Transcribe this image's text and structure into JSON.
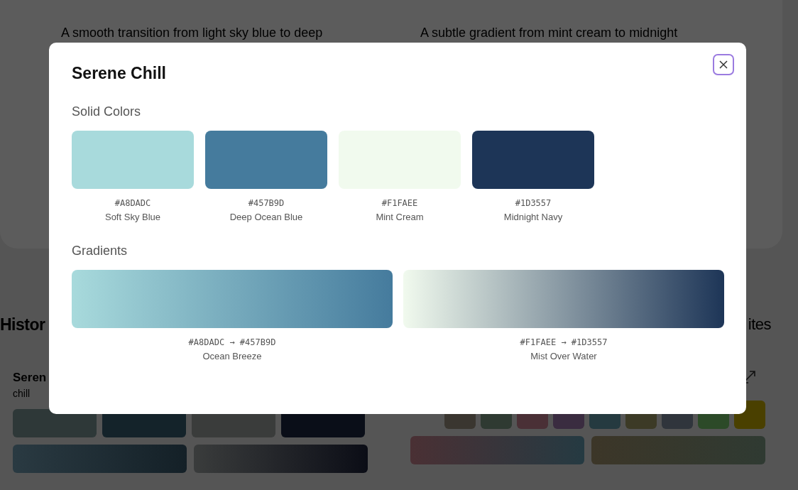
{
  "background": {
    "descriptions": [
      "A smooth transition from light sky blue to deep",
      "A subtle gradient from mint cream to midnight"
    ],
    "history_heading": "Histor",
    "favorites_heading": "ites",
    "history_card": {
      "title": "Seren",
      "tag": "chill",
      "swatches": [
        {
          "color": "#2e3838"
        },
        {
          "color": "#14232a"
        },
        {
          "color": "#3a3c3b"
        },
        {
          "color": "#0a0e18"
        }
      ]
    },
    "favorites_card": {
      "swatches": [
        {
          "color": "#3a3630"
        },
        {
          "color": "#2f3a32"
        },
        {
          "color": "#4a3036"
        },
        {
          "color": "#3a2c40"
        },
        {
          "color": "#253a40"
        },
        {
          "color": "#3c3a26"
        },
        {
          "color": "#30353c"
        },
        {
          "color": "#2c4a28"
        },
        {
          "color": "#4a4000"
        }
      ]
    }
  },
  "modal": {
    "title": "Serene Chill",
    "solid_heading": "Solid Colors",
    "gradients_heading": "Gradients",
    "colors": [
      {
        "hex": "#A8DADC",
        "name": "Soft Sky Blue",
        "color": "#a8dadc"
      },
      {
        "hex": "#457B9D",
        "name": "Deep Ocean Blue",
        "color": "#457b9d"
      },
      {
        "hex": "#F1FAEE",
        "name": "Mint Cream",
        "color": "#f1faee"
      },
      {
        "hex": "#1D3557",
        "name": "Midnight Navy",
        "color": "#1d3557"
      }
    ],
    "gradients": [
      {
        "from_hex": "#A8DADC",
        "arrow": "→",
        "to_hex": "#457B9D",
        "name": "Ocean Breeze"
      },
      {
        "from_hex": "#F1FAEE",
        "arrow": "→",
        "to_hex": "#1D3557",
        "name": "Mist Over Water"
      }
    ]
  }
}
